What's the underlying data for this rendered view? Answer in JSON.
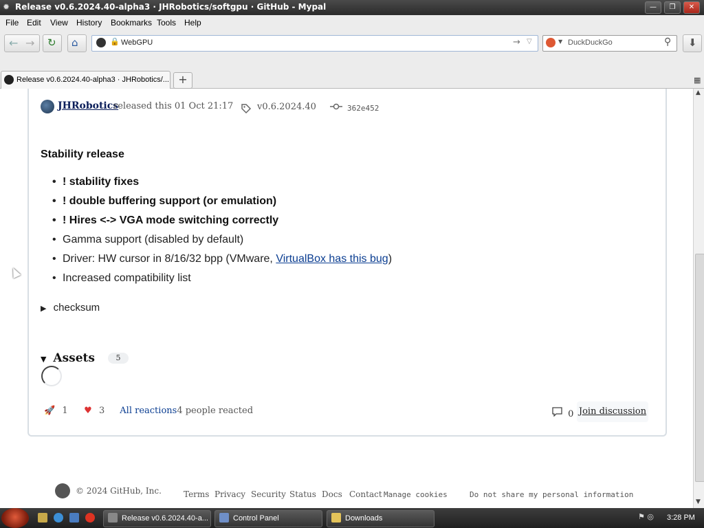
{
  "window": {
    "title": "Release v0.6.2024.40-alpha3 · JHRobotics/softgpu · GitHub - Mypal",
    "minimize_glyph": "—",
    "maximize_glyph": "❐",
    "close_glyph": "✕"
  },
  "menu": {
    "file": "File",
    "edit": "Edit",
    "view": "View",
    "history": "History",
    "bookmarks": "Bookmarks",
    "tools": "Tools",
    "help": "Help"
  },
  "nav": {
    "url_text": "WebGPU",
    "search_placeholder": "DuckDuckGo"
  },
  "tabs": {
    "active_label": "Release v0.6.2024.40-alpha3 · JHRobotics/...",
    "new_tab_glyph": "+"
  },
  "release": {
    "author": "JHRobotics",
    "released_text": "released this 01 Oct 21:17",
    "tag": "v0.6.2024.40",
    "commit": "362e452",
    "heading": "Stability release",
    "bullets": [
      {
        "text": "! stability fixes"
      },
      {
        "text": "! double buffering support (or emulation)"
      },
      {
        "text": "! Hires <-> VGA mode switching correctly"
      },
      {
        "text": "Gamma support (disabled by default)"
      },
      {
        "prefix": "Driver: HW cursor in 8/16/32 bpp (VMware, ",
        "link": "VirtualBox has this bug",
        "suffix": ")"
      },
      {
        "text": "Increased compatibility list"
      }
    ],
    "checksum_label": "checksum",
    "assets_label": "Assets",
    "assets_count": "5",
    "reaction_rocket_count": "1",
    "reaction_heart_count": "3",
    "all_reactions": "All reactions",
    "people_reacted": "4 people reacted",
    "comment_count": "0",
    "join_discussion": "Join discussion"
  },
  "footer": {
    "copyright": "© 2024 GitHub, Inc.",
    "terms": "Terms",
    "privacy": "Privacy",
    "security": "Security",
    "status": "Status",
    "docs": "Docs",
    "contact": "Contact",
    "manage_cookies": "Manage cookies",
    "do_not_share": "Do not share my personal information"
  },
  "taskbar": {
    "items": [
      {
        "label": "Release v0.6.2024.40-a..."
      },
      {
        "label": "Control Panel"
      },
      {
        "label": "Downloads"
      }
    ],
    "clock": "3:28 PM"
  },
  "icons": {
    "tag": "tag-icon",
    "commit": "commit-icon",
    "rocket": "rocket-icon",
    "heart": "heart-icon",
    "comment": "comment-icon",
    "github": "github-logo-icon"
  },
  "colors": {
    "link": "#0a3d91",
    "titlebar": "#2b2b2b"
  }
}
